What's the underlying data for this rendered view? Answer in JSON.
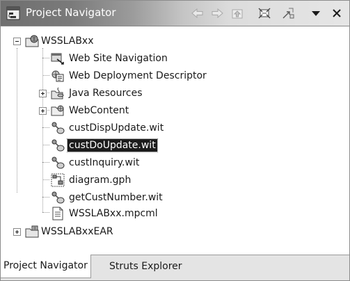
{
  "window": {
    "title": "Project Navigator",
    "toolbar": [
      {
        "name": "back-icon",
        "label": "Back"
      },
      {
        "name": "forward-icon",
        "label": "Forward"
      },
      {
        "name": "up-icon",
        "label": "Up"
      },
      {
        "name": "collapse-all-icon",
        "label": "Collapse All"
      },
      {
        "name": "link-with-editor-icon",
        "label": "Link with Editor"
      },
      {
        "name": "view-menu-icon",
        "label": "Menu"
      },
      {
        "name": "close-icon",
        "label": "Close"
      }
    ]
  },
  "tree": {
    "root_project": {
      "label": "WSSLABxx",
      "expanded": true,
      "icon": "web-project-icon",
      "children": [
        {
          "label": "Web Site Navigation",
          "icon": "site-navigation-icon"
        },
        {
          "label": "Web Deployment Descriptor",
          "icon": "deployment-descriptor-icon"
        },
        {
          "label": "Java Resources",
          "icon": "java-resources-icon",
          "expandable": true,
          "expanded": false
        },
        {
          "label": "WebContent",
          "icon": "folder-icon",
          "expandable": true,
          "expanded": false
        },
        {
          "label": "custDispUpdate.wit",
          "icon": "wit-file-icon"
        },
        {
          "label": "custDoUpdate.wit",
          "icon": "wit-file-icon",
          "selected": true
        },
        {
          "label": "custInquiry.wit",
          "icon": "wit-file-icon"
        },
        {
          "label": "diagram.gph",
          "icon": "diagram-file-icon"
        },
        {
          "label": "getCustNumber.wit",
          "icon": "wit-file-icon"
        },
        {
          "label": "WSSLABxx.mpcml",
          "icon": "text-file-icon"
        }
      ]
    },
    "ear_project": {
      "label": "WSSLABxxEAR",
      "icon": "ear-project-icon",
      "expandable": true,
      "expanded": false
    }
  },
  "tabs": [
    {
      "label": "Project Navigator",
      "active": true
    },
    {
      "label": "Struts Explorer",
      "active": false
    }
  ],
  "colors": {
    "title_gradient_start": "#6f6f6f",
    "title_gradient_end": "#e6e6e6",
    "selection_bg": "#1c1c1c",
    "selection_fg": "#ffffff"
  }
}
